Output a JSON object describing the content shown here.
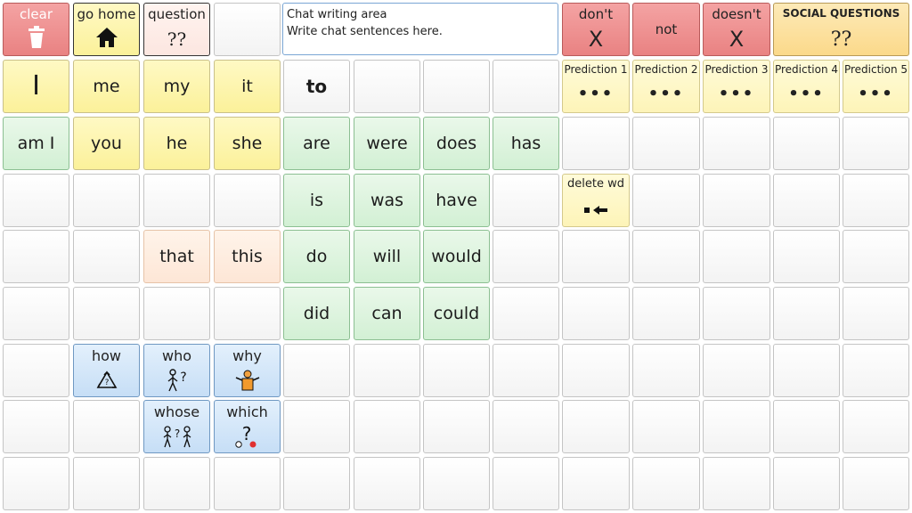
{
  "toolbar": {
    "clear_label": "clear",
    "home_label": "go home",
    "question_label": "question",
    "question_icon_text": "??",
    "dont_label": "don't",
    "dont_icon": "X",
    "not_label": "not",
    "doesnt_label": "doesn't",
    "doesnt_icon": "X",
    "social_label": "SOCIAL QUESTIONS",
    "social_icon_text": "??"
  },
  "chat_area": {
    "title": "Chat writing area",
    "placeholder": "Write chat sentences here."
  },
  "pronouns": {
    "I": "I",
    "me": "me",
    "my": "my",
    "it": "it",
    "am_i": "am I",
    "you": "you",
    "he": "he",
    "she": "she"
  },
  "words": {
    "to": "to",
    "are": "are",
    "were": "were",
    "does": "does",
    "has": "has",
    "is": "is",
    "was": "was",
    "have": "have",
    "that": "that",
    "this": "this",
    "do": "do",
    "will": "will",
    "would": "would",
    "did": "did",
    "can": "can",
    "could": "could"
  },
  "questions": {
    "how": "how",
    "who": "who",
    "why": "why",
    "whose": "whose",
    "which": "which"
  },
  "predictions": [
    {
      "label": "Prediction 1",
      "dots": "•••"
    },
    {
      "label": "Prediction 2",
      "dots": "•••"
    },
    {
      "label": "Prediction 3",
      "dots": "•••"
    },
    {
      "label": "Prediction 4",
      "dots": "•••"
    },
    {
      "label": "Prediction 5",
      "dots": "•••"
    }
  ],
  "delete_word": {
    "label": "delete wd"
  },
  "colors": {
    "clear_red": "#e98282",
    "yellow": "#fbf19a",
    "green": "#d2f0d4",
    "blue": "#c6def6",
    "peach": "#fde6d6",
    "social": "#fbd98a"
  }
}
